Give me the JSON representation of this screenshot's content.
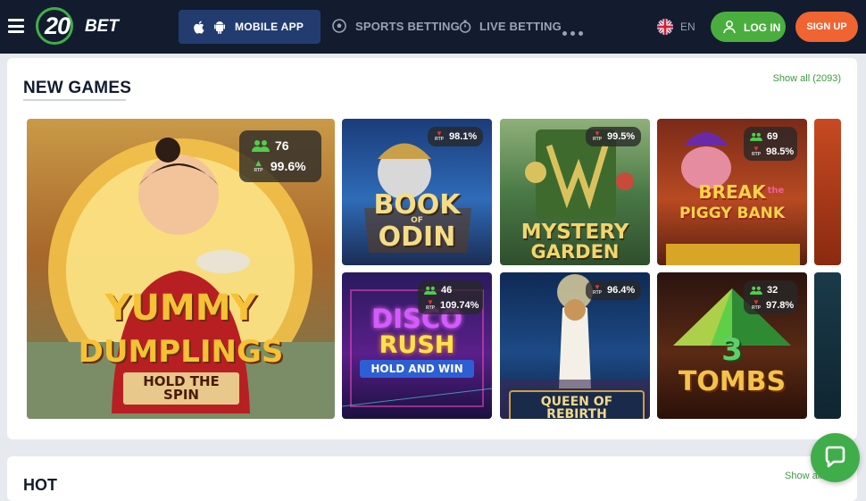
{
  "header": {
    "logo_num": "20",
    "logo_word": "BET",
    "mobile_app_label": "MOBILE APP",
    "nav": [
      {
        "label": "SPORTS BETTING",
        "icon": "soccer-ball-icon"
      },
      {
        "label": "LIVE BETTING",
        "icon": "stopwatch-icon"
      }
    ],
    "more_icon": "more-dots-icon",
    "language": "EN",
    "login_label": "LOG IN",
    "signup_label": "SIGN UP"
  },
  "new_games": {
    "title": "NEW GAMES",
    "show_all": "Show all (2093)",
    "rtp_label": "RTP",
    "games": [
      {
        "name_lines": [
          "YUMMY",
          "DUMPLINGS"
        ],
        "subtitle": "HOLD THE SPIN",
        "players": "76",
        "rtp": "99.6%"
      },
      {
        "name_lines": [
          "BOOK",
          "ODIN"
        ],
        "subtitle": "OF",
        "players": "",
        "rtp": "98.1%"
      },
      {
        "name_lines": [
          "MYSTERY",
          "GARDEN"
        ],
        "subtitle": "",
        "players": "",
        "rtp": "99.5%"
      },
      {
        "name_lines": [
          "BREAK",
          "PIGGY BANK"
        ],
        "subtitle": "the",
        "players": "69",
        "rtp": "98.5%"
      },
      {
        "name_lines": [
          "DISCO",
          "RUSH"
        ],
        "subtitle": "HOLD AND WIN",
        "players": "46",
        "rtp": "109.74%"
      },
      {
        "name_lines": [
          "QUEEN OF REBIRTH"
        ],
        "subtitle": "",
        "players": "",
        "rtp": "96.4%"
      },
      {
        "name_lines": [
          "3",
          "TOMBS"
        ],
        "subtitle": "",
        "players": "32",
        "rtp": "97.8%"
      }
    ]
  },
  "hot": {
    "title": "HOT",
    "show_all": "Show all ("
  },
  "colors": {
    "header_bg": "#121c2e",
    "mobile_app_bg": "#233c70",
    "login_green": "#4aae3e",
    "signup_orange": "#f06431",
    "link_green": "#3f9a41"
  }
}
